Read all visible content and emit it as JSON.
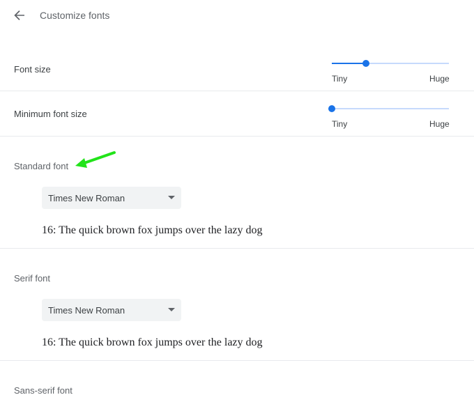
{
  "header": {
    "title": "Customize fonts",
    "back_icon": "arrow-back-icon"
  },
  "font_size": {
    "label": "Font size",
    "min_label": "Tiny",
    "max_label": "Huge",
    "value_fraction": 0.29
  },
  "minimum_font_size": {
    "label": "Minimum font size",
    "min_label": "Tiny",
    "max_label": "Huge",
    "value_fraction": 0.0
  },
  "standard_font": {
    "title": "Standard font",
    "selected": "Times New Roman",
    "sample": "16: The quick brown fox jumps over the lazy dog"
  },
  "serif_font": {
    "title": "Serif font",
    "selected": "Times New Roman",
    "sample": "16: The quick brown fox jumps over the lazy dog"
  },
  "sans_serif_font": {
    "title": "Sans-serif font"
  },
  "colors": {
    "accent": "#1a73e8",
    "track": "#c6dafc",
    "annotation": "#22e31a"
  }
}
